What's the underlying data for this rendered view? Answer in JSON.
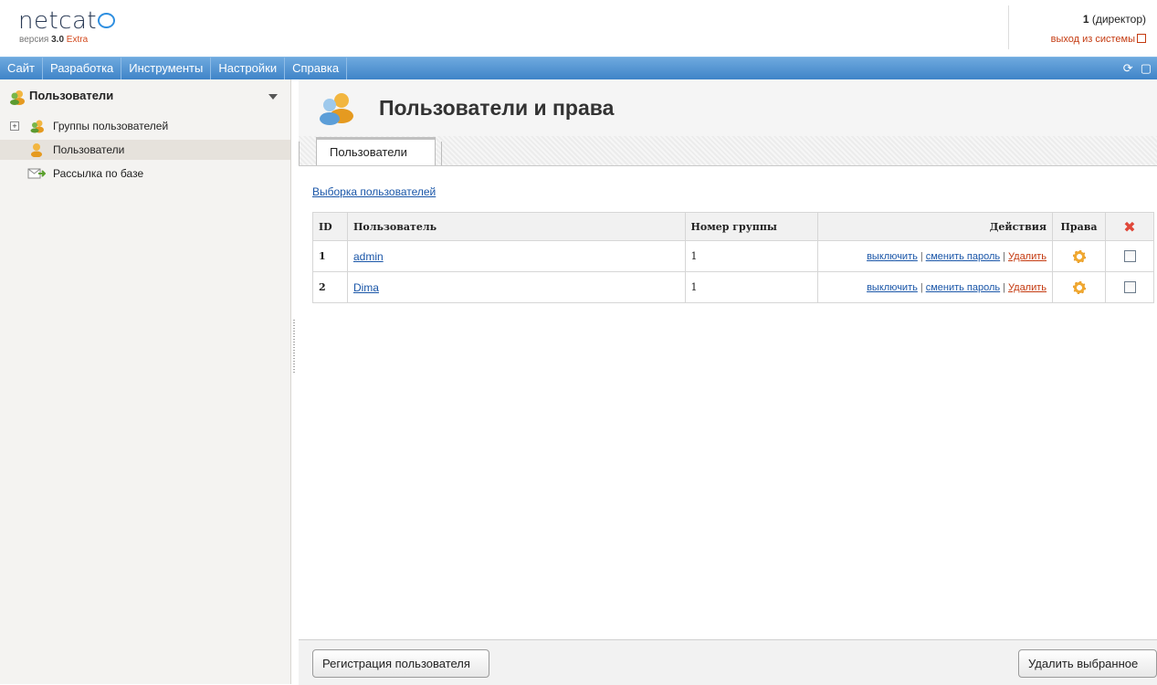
{
  "header": {
    "logo": "netcat",
    "version_prefix": "версия",
    "version_number": "3.0",
    "version_edition": "Extra",
    "user_id": "1",
    "user_role": "(директор)",
    "logout_label": "выход из системы"
  },
  "menu": {
    "items": [
      "Сайт",
      "Разработка",
      "Инструменты",
      "Настройки",
      "Справка"
    ],
    "icons": [
      "refresh-icon",
      "chat-icon"
    ]
  },
  "sidebar": {
    "title": "Пользователи",
    "items": [
      {
        "label": "Группы пользователей",
        "icon": "user-group-icon",
        "expandable": true
      },
      {
        "label": "Пользователи",
        "icon": "user-icon",
        "selected": true
      },
      {
        "label": "Рассылка по базе",
        "icon": "mail-icon"
      }
    ]
  },
  "main": {
    "title": "Пользователи и права",
    "tabs": [
      {
        "label": "Пользователи"
      }
    ],
    "selection_link": "Выборка пользователей",
    "table": {
      "headers": [
        "ID",
        "Пользователь",
        "Номер группы",
        "Действия",
        "Права"
      ],
      "rows": [
        {
          "id": "1",
          "user": "admin",
          "group": "1",
          "disable": "выключить",
          "change_pw": "сменить пароль",
          "delete": "Удалить"
        },
        {
          "id": "2",
          "user": "Dima",
          "group": "1",
          "disable": "выключить",
          "change_pw": "сменить пароль",
          "delete": "Удалить"
        }
      ]
    },
    "buttons": {
      "register": "Регистрация пользователя",
      "delete_selected": "Удалить выбранное"
    }
  },
  "colors": {
    "menubar": "#4a8fd0",
    "link": "#1a56a8",
    "danger": "#c43a10"
  }
}
